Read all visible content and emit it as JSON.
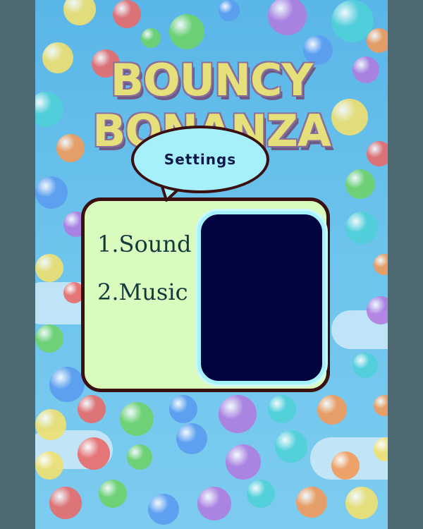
{
  "game": {
    "title_line1": "BOUNCY",
    "title_line2": "BONANZA"
  },
  "settings": {
    "title": "Settings",
    "items": [
      {
        "label": "1.Sound"
      },
      {
        "label": "2.Music"
      }
    ]
  },
  "colors": {
    "sky": "#5ab6e8",
    "panel_bg": "#dafbbe",
    "panel_border": "#3a1010",
    "title_bubble": "#a6f0fb",
    "dark_box": "#02043f",
    "letterbox": "#4d6a72"
  }
}
